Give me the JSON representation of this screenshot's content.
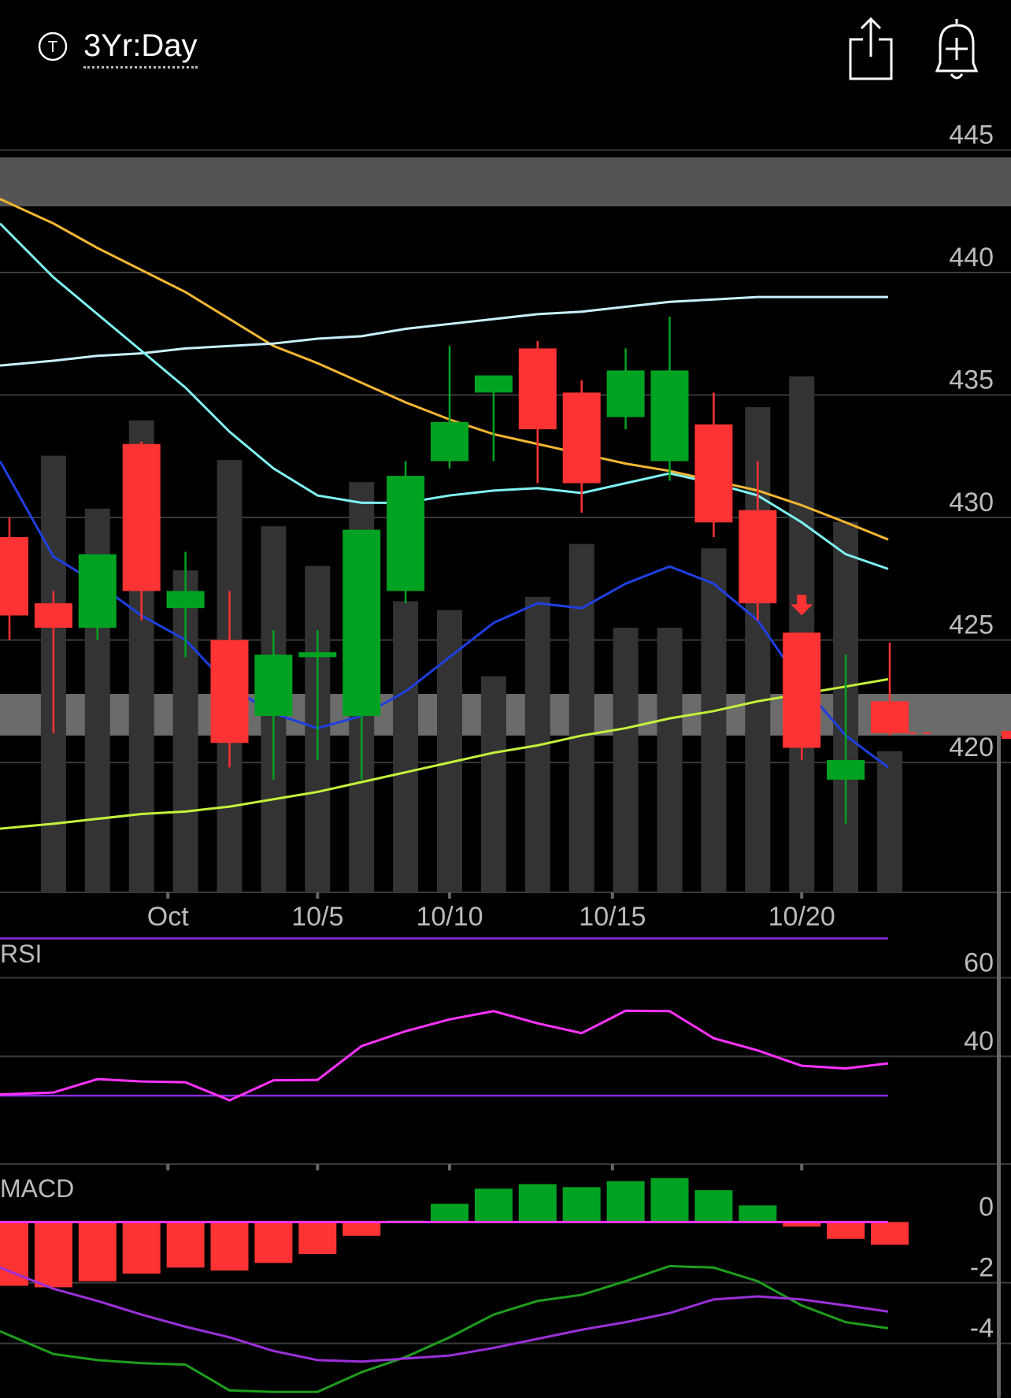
{
  "header": {
    "timeframe": "3Yr:Day",
    "ticker_icon_letter": "T",
    "icons": [
      "ticker-icon",
      "share-icon",
      "alert-bell-icon"
    ]
  },
  "colors": {
    "up": "#00A321",
    "down": "#FF3333",
    "volume": "#333333",
    "grid": "#3A3A3A",
    "axis_text": "#BBBBBB",
    "ma_orange": "#F2B632",
    "ma_lightblue": "#C8F0FA",
    "ma_cyan": "#7FF2F2",
    "ma_blue": "#1F3FE0",
    "ma_green": "#C3F23A",
    "rsi_line": "#FF33FF",
    "rsi_band": "#8A2BE2",
    "macd_line": "#1E9E1E",
    "macd_signal": "#9B30D8",
    "macd_zero": "#FF33FF"
  },
  "chart_data": [
    {
      "type": "candlestick",
      "name": "price",
      "y_ticks": [
        445,
        440,
        435,
        430,
        425,
        420
      ],
      "ylim": [
        414.7,
        446.3
      ],
      "x_tick_labels": [
        {
          "label": "Oct",
          "index": 3.6
        },
        {
          "label": "10/5",
          "index": 7
        },
        {
          "label": "10/10",
          "index": 10
        },
        {
          "label": "10/15",
          "index": 13.7
        },
        {
          "label": "10/20",
          "index": 18
        }
      ],
      "bands": [
        {
          "from": 442.7,
          "to": 444.7,
          "opacity": 0.33
        },
        {
          "from": 421.1,
          "to": 422.8,
          "opacity": 0.42
        }
      ],
      "candles": [
        {
          "o": 429.2,
          "h": 430.0,
          "l": 425.0,
          "c": 426.0
        },
        {
          "o": 426.5,
          "h": 427.0,
          "l": 421.2,
          "c": 425.5
        },
        {
          "o": 425.5,
          "h": 428.1,
          "l": 425.0,
          "c": 428.5
        },
        {
          "o": 433.0,
          "h": 433.1,
          "l": 425.8,
          "c": 427.0
        },
        {
          "o": 426.3,
          "h": 428.6,
          "l": 424.3,
          "c": 427.0
        },
        {
          "o": 425.0,
          "h": 427.0,
          "l": 419.8,
          "c": 420.8
        },
        {
          "o": 421.9,
          "h": 425.4,
          "l": 419.3,
          "c": 424.4
        },
        {
          "o": 424.3,
          "h": 425.4,
          "l": 420.1,
          "c": 424.5
        },
        {
          "o": 421.9,
          "h": 427.8,
          "l": 419.3,
          "c": 429.5
        },
        {
          "o": 427.0,
          "h": 432.3,
          "l": 426.5,
          "c": 431.7
        },
        {
          "o": 432.3,
          "h": 437.0,
          "l": 432.0,
          "c": 433.9
        },
        {
          "o": 435.1,
          "h": 435.8,
          "l": 432.3,
          "c": 435.8
        },
        {
          "o": 436.9,
          "h": 437.2,
          "l": 431.4,
          "c": 433.6
        },
        {
          "o": 435.1,
          "h": 435.6,
          "l": 430.2,
          "c": 431.4
        },
        {
          "o": 434.1,
          "h": 436.9,
          "l": 433.6,
          "c": 436.0
        },
        {
          "o": 432.3,
          "h": 438.2,
          "l": 431.5,
          "c": 436.0
        },
        {
          "o": 433.8,
          "h": 435.1,
          "l": 429.2,
          "c": 429.8
        },
        {
          "o": 430.3,
          "h": 432.3,
          "l": 425.8,
          "c": 426.5
        },
        {
          "o": 425.3,
          "h": 425.3,
          "l": 420.1,
          "c": 420.6
        },
        {
          "o": 419.3,
          "h": 424.4,
          "l": 417.5,
          "c": 420.1
        },
        {
          "o": 422.5,
          "h": 424.9,
          "l": 421.1,
          "c": 421.2
        }
      ],
      "volume": {
        "scale_max": 1.0,
        "values": [
          0.0,
          0.99,
          0.87,
          1.07,
          0.73,
          0.98,
          0.83,
          0.74,
          0.93,
          0.66,
          0.64,
          0.49,
          0.67,
          0.79,
          0.6,
          0.6,
          0.78,
          1.1,
          1.17,
          0.84,
          0.32
        ]
      },
      "moving_averages": [
        {
          "color": "ma_orange",
          "values": [
            443.0,
            442.0,
            441.0,
            440.1,
            439.2,
            438.1,
            437.0,
            436.3,
            435.5,
            434.7,
            434.0,
            433.4,
            433.0,
            432.6,
            432.2,
            431.9,
            431.5,
            431.1,
            430.5,
            429.8,
            429.1
          ]
        },
        {
          "color": "ma_lightblue",
          "values": [
            436.2,
            436.4,
            436.6,
            436.7,
            436.9,
            437.0,
            437.1,
            437.3,
            437.4,
            437.7,
            437.9,
            438.1,
            438.3,
            438.4,
            438.6,
            438.8,
            438.9,
            439.0,
            439.0,
            439.0,
            439.0
          ]
        },
        {
          "color": "ma_cyan",
          "values": [
            442.0,
            439.8,
            438.3,
            436.8,
            435.3,
            433.5,
            432.0,
            430.9,
            430.6,
            430.6,
            430.9,
            431.1,
            431.2,
            431.0,
            431.4,
            431.8,
            431.4,
            430.9,
            429.8,
            428.5,
            427.9
          ]
        },
        {
          "color": "ma_blue",
          "values": [
            432.3,
            428.4,
            427.3,
            426.0,
            425.0,
            423.1,
            422.0,
            421.4,
            421.9,
            422.9,
            424.3,
            425.7,
            426.5,
            426.3,
            427.3,
            428.0,
            427.3,
            425.8,
            423.2,
            421.1,
            419.8
          ]
        },
        {
          "color": "ma_green",
          "values": [
            417.3,
            417.5,
            417.7,
            417.9,
            418.0,
            418.2,
            418.5,
            418.8,
            419.2,
            419.6,
            420.0,
            420.4,
            420.7,
            421.1,
            421.4,
            421.8,
            422.1,
            422.5,
            422.8,
            423.1,
            423.4
          ]
        }
      ],
      "signal_marker": {
        "index": 18,
        "direction": "down"
      }
    },
    {
      "type": "line",
      "name": "RSI",
      "title": "RSI",
      "y_ticks": [
        60,
        40
      ],
      "ylim": [
        22.2,
        69.1
      ],
      "bands": [
        30,
        70
      ],
      "values": [
        30.3,
        30.8,
        34.2,
        33.6,
        33.4,
        28.8,
        33.9,
        34.0,
        42.6,
        46.4,
        49.4,
        51.5,
        48.4,
        45.9,
        51.6,
        51.5,
        44.6,
        41.5,
        37.6,
        36.9,
        38.2
      ]
    },
    {
      "type": "bar",
      "name": "MACD",
      "title": "MACD",
      "y_ticks": [
        0,
        -2,
        -4
      ],
      "ylim": [
        -5.8,
        1.6
      ],
      "histogram": [
        -2.1,
        -2.15,
        -1.95,
        -1.7,
        -1.5,
        -1.6,
        -1.35,
        -1.05,
        -0.45,
        0.05,
        0.6,
        1.1,
        1.25,
        1.15,
        1.35,
        1.45,
        1.05,
        0.55,
        -0.15,
        -0.55,
        -0.75
      ],
      "macd_line": [
        -3.6,
        -4.35,
        -4.55,
        -4.65,
        -4.7,
        -5.55,
        -5.6,
        -5.6,
        -4.95,
        -4.45,
        -3.8,
        -3.05,
        -2.6,
        -2.4,
        -1.95,
        -1.45,
        -1.5,
        -1.95,
        -2.75,
        -3.3,
        -3.5
      ],
      "signal_line": [
        -1.5,
        -2.2,
        -2.6,
        -3.05,
        -3.45,
        -3.8,
        -4.25,
        -4.55,
        -4.6,
        -4.5,
        -4.4,
        -4.15,
        -3.85,
        -3.55,
        -3.3,
        -3.0,
        -2.55,
        -2.45,
        -2.55,
        -2.75,
        -2.95
      ]
    }
  ]
}
